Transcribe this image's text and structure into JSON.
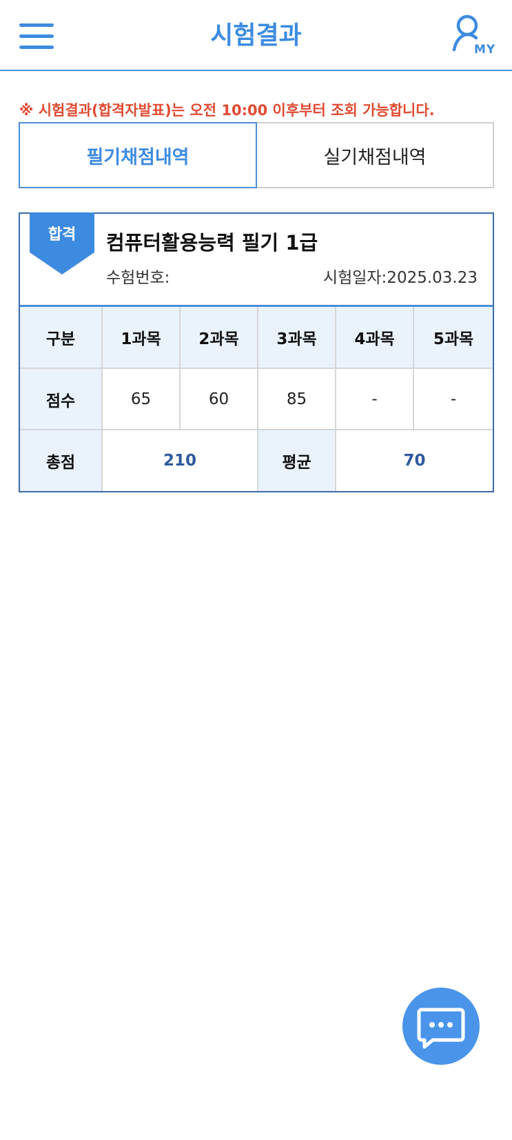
{
  "header": {
    "title": "시험결과",
    "menu_icon": "hamburger-menu-icon",
    "my_label": "MY",
    "my_icon": "user-profile-icon"
  },
  "notice": "※ 시험결과(합격자발표)는 오전 10:00 이후부터 조회 가능합니다.",
  "tabs": [
    {
      "label": "필기채점내역",
      "active": true
    },
    {
      "label": "실기채점내역",
      "active": false
    }
  ],
  "result": {
    "status": "합격",
    "exam_name": "컴퓨터활용능력 필기 1급",
    "exam_number_label": "수험번호:",
    "exam_date_label": "시험일자:2025.03.23"
  },
  "score_table": {
    "header_label": "구분",
    "subjects": [
      "1과목",
      "2과목",
      "3과목",
      "4과목",
      "5과목"
    ],
    "score_label": "점수",
    "scores": [
      "65",
      "60",
      "85",
      "-",
      "-"
    ],
    "total_label": "총점",
    "total": "210",
    "average_label": "평균",
    "average": "70"
  },
  "chat_fab": {
    "icon": "chat-bubble-icon"
  },
  "colors": {
    "accent": "#3d8be0",
    "notice": "#e04a32",
    "header_cell": "#eaf2fc",
    "total_value": "#2d5a9c",
    "card_border": "#3a6aa5"
  }
}
